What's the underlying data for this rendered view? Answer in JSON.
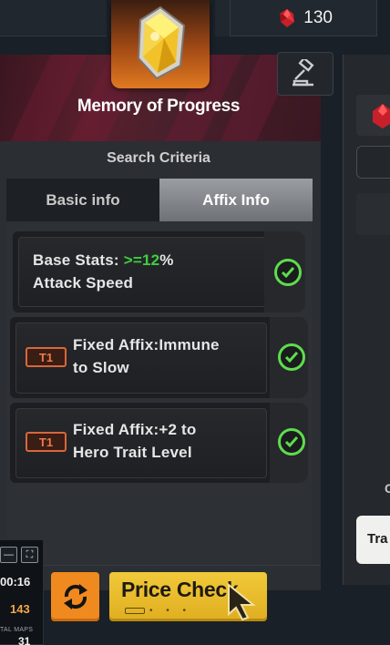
{
  "currency": {
    "amount": "130",
    "icon": "red-crystal-icon"
  },
  "item": {
    "name": "Memory of Progress",
    "icon": "yellow-gem-memory-icon",
    "frame_color": "#e07a21"
  },
  "search": {
    "heading": "Search Criteria",
    "tabs": [
      {
        "label": "Basic info",
        "active": false
      },
      {
        "label": "Affix Info",
        "active": true
      }
    ],
    "criteria": [
      {
        "prefix": "Base Stats: ",
        "value": ">=12",
        "suffix": "%",
        "line2": "Attack Speed",
        "tier": "",
        "checked": true
      },
      {
        "line1": "Fixed Affix:Immune",
        "line2": "to Slow",
        "tier": "T1",
        "checked": true
      },
      {
        "line1": "Fixed Affix:+2 to",
        "line2": "Hero Trait Level",
        "tier": "T1",
        "checked": true
      }
    ]
  },
  "right_panel": {
    "partial_letter": "C",
    "partial_button": "Tra"
  },
  "overlay": {
    "timer": "00:16",
    "count": "143",
    "label": "TAL MAPS",
    "maps": "31"
  },
  "actions": {
    "price_check_label": "Price Check"
  },
  "colors": {
    "accent_green": "#3fcf3f",
    "tier_orange": "#ef7a4a",
    "price_yellow": "#f1c93a",
    "refresh_orange": "#f08a1f"
  }
}
